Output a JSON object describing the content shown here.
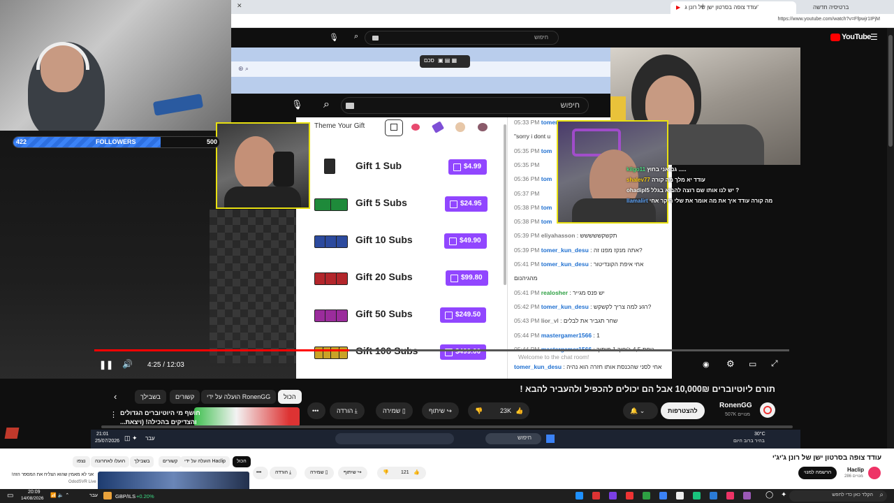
{
  "browser": {
    "tab_active": "עודד צופה בסרטון ישן של רונן ג'",
    "tab_other": "ברטיסיה חדשה",
    "url": "https://www.youtube.com/watch?v=Ffpwjr1IPjM"
  },
  "youtube": {
    "logo": "YouTube",
    "search_placeholder": "חיפוש"
  },
  "inner_youtube": {
    "search_placeholder": "חיפוש",
    "screenshot_toolbar_label": "סכם"
  },
  "followers": {
    "label": "FOLLOWERS",
    "current": "422",
    "goal": "500",
    "fraction": 0.844
  },
  "gift_panel": {
    "theme_label": "Theme Your Gift",
    "items": [
      {
        "name": "Gift 1 Sub",
        "price": "$4.99",
        "color": "#2a2a2a"
      },
      {
        "name": "Gift 5 Subs",
        "price": "$24.95",
        "color": "#1e8a3a"
      },
      {
        "name": "Gift 10 Subs",
        "price": "$49.90",
        "color": "#2c4a9e"
      },
      {
        "name": "Gift 20 Subs",
        "price": "$99.80",
        "color": "#b3262b"
      },
      {
        "name": "Gift 50 Subs",
        "price": "$249.50",
        "color": "#9b2c9c"
      },
      {
        "name": "Gift 100 Subs",
        "price": "$499.00",
        "color": "#c9a227"
      }
    ]
  },
  "chat": {
    "welcome": "Welcome to the chat room!",
    "lines": [
      {
        "time": "05:33 PM",
        "user": "tomer_kun_desu",
        "msg": "",
        "color": "#1e6fd0"
      },
      {
        "time": "",
        "user": "",
        "msg": "\"sorry i dont u",
        "color": "#333"
      },
      {
        "time": "05:35 PM",
        "user": "tom",
        "msg": "",
        "color": "#1e6fd0"
      },
      {
        "time": "05:35 PM",
        "user": "",
        "msg": "",
        "color": "#1e6fd0"
      },
      {
        "time": "05:36 PM",
        "user": "tom",
        "msg": "",
        "color": "#1e6fd0"
      },
      {
        "time": "05:37 PM",
        "user": "",
        "msg": "",
        "color": "#1e6fd0"
      },
      {
        "time": "05:38 PM",
        "user": "tom",
        "msg": "",
        "color": "#1e6fd0"
      },
      {
        "time": "05:38 PM",
        "user": "tom",
        "msg": "",
        "color": "#1e6fd0"
      },
      {
        "time": "05:39 PM",
        "user": "eliyahasson",
        "msg": ": תקשקששששש",
        "color": "#7d7d7d"
      },
      {
        "time": "05:39 PM",
        "user": "tomer_kun_desu",
        "msg": ": אתה מנקז מפנו זה?",
        "color": "#1e6fd0"
      },
      {
        "time": "05:41 PM",
        "user": "tomer_kun_desu",
        "msg": ": אחי איפת הקונדיטור",
        "color": "#1e6fd0"
      },
      {
        "time": "",
        "user": "",
        "msg": "מהגיהנום",
        "color": "#333"
      },
      {
        "time": "05:41 PM",
        "user": "realosher",
        "msg": ": יש פנס מגייר",
        "color": "#2ea043"
      },
      {
        "time": "05:42 PM",
        "user": "tomer_kun_desu",
        "msg": ": רגע למה צריך לקשקש?",
        "color": "#1e6fd0"
      },
      {
        "time": "05:43 PM",
        "user": "lior_vl",
        "msg": ": שחר תגביר את לבלים",
        "color": "#7d7d7d"
      },
      {
        "time": "05:44 PM",
        "user": "mastergamer1566",
        "msg": ": 1",
        "color": "#1e6fd0"
      },
      {
        "time": "05:44 PM",
        "user": "mastergamer1566",
        "msg": ": גופת 4,5 ג'יפוך 1 מיתוך",
        "color": "#1e6fd0"
      }
    ],
    "last_user": "tomer_kun_desu",
    "last_msg": ": אחי לסני שהכנסת אותו חזרה הוא נהיה"
  },
  "overlay_chat": [
    {
      "user": "kilgo11",
      "msg": "גם אני בחוץ .....",
      "color": "#4ade80"
    },
    {
      "user": "shalev77",
      "msg": "עודד יא מלך מה קורה",
      "color": "#facc15"
    },
    {
      "user": "ohadipl5",
      "msg": "יש לנו אותו שם רוצה להביא בגלל ?",
      "color": "#ffffff"
    },
    {
      "user": "llamalirt",
      "msg": "מה קורה עודד איך את מה אומר את שלי היקר אחי",
      "color": "#60a5fa"
    }
  ],
  "player": {
    "time": "4:25 / 12:03",
    "progress_fraction": 0.367
  },
  "video_info": {
    "title": "תורם ליוטיוברים 10,000₪ אבל הם יכולים להכפיל ולהעביר להבא !",
    "channel": "RonenGG",
    "subscribers": "507K מנויים",
    "subscribe_label": "להצטרפות",
    "likes": "23K",
    "share": "שיתוף",
    "save": "שמירה",
    "download": "הורדה"
  },
  "chips": [
    "הכול",
    "הועלה על ידי RonenGG",
    "קשורים",
    "בשבילך"
  ],
  "related": {
    "title_line1": "חושף מי היוטיוברים הגדולים",
    "title_line2": "והצדיקים בהכילה! (ויצאת..."
  },
  "inner_taskbar": {
    "time": "21:01",
    "date": "25/07/2026",
    "lang": "עבר",
    "search": "חיפוש",
    "weather_temp": "30°C",
    "weather_desc": "בהיר ברוב היום"
  },
  "bottom_page": {
    "title": "עודד צופה בסרטון ישן של רונן ג'יג'י",
    "channel": "Haclip",
    "subscribers": "286 מנויים",
    "subscribe_label": "הרשמה למנוי",
    "likes": "121",
    "share": "שיתוף",
    "save": "שמירה",
    "download": "הורדה",
    "chips": [
      "הכול",
      "הועלה על ידי Haclip",
      "קשורים",
      "בשבילך",
      "הועלו לאחרונה",
      "נצפו"
    ],
    "related_title": "אני לא מאמין שהוא הצליח את המספר הזה!",
    "related_channel": "OdodSVR Live"
  },
  "taskbar": {
    "time": "20:09",
    "date": "14/08/2026",
    "ticker": "GBP/ILS",
    "ticker_change": "+0.20%",
    "search": "הקלד כאן כדי לחפש",
    "lang": "עבר"
  }
}
